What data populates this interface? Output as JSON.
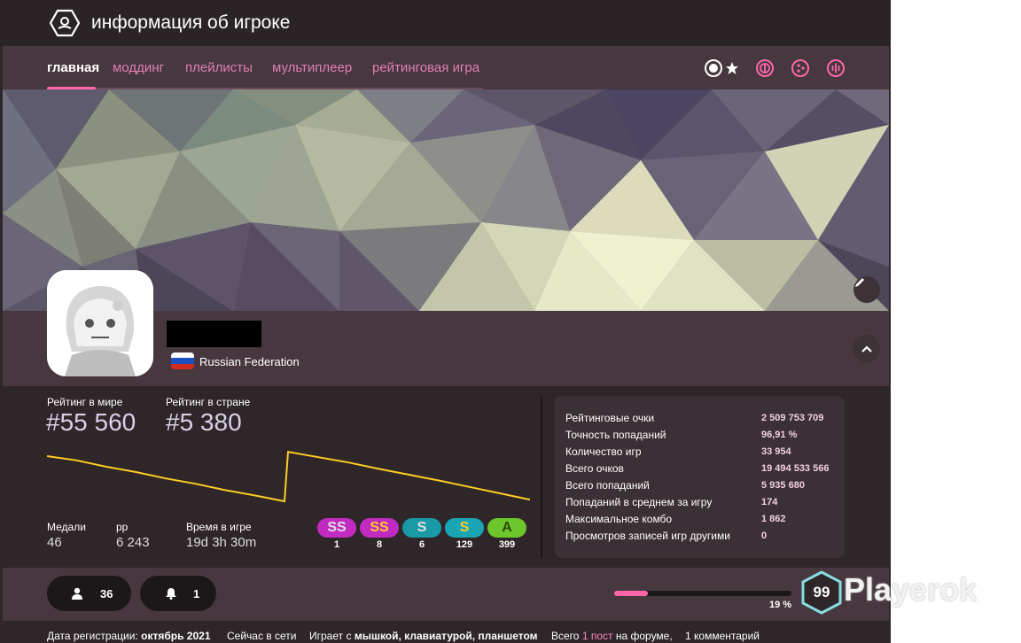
{
  "header": {
    "title": "информация об игроке",
    "icon": "user-card-icon"
  },
  "nav": {
    "tabs": [
      {
        "label": "главная",
        "active": true
      },
      {
        "label": "моддинг",
        "active": false
      },
      {
        "label": "плейлисты",
        "active": false
      },
      {
        "label": "мультиплеер",
        "active": false
      },
      {
        "label": "рейтинговая игра",
        "active": false
      }
    ],
    "mode_icons": [
      "osu-mode-icon",
      "taiko-mode-icon",
      "catch-mode-icon",
      "mania-mode-icon"
    ],
    "default_mode_marker": "star-icon"
  },
  "profile": {
    "country": "Russian Federation",
    "username_redacted": true
  },
  "ranks": {
    "global_label": "Рейтинг в мире",
    "global_value": "#55 560",
    "country_label": "Рейтинг в стране",
    "country_value": "#5 380"
  },
  "rank_history": {
    "type": "line",
    "description": "rank history",
    "values": [
      0.1,
      0.18,
      0.3,
      0.4,
      0.52,
      0.62,
      0.74,
      0.84,
      0.95,
      0.02,
      0.12,
      0.22,
      0.34,
      0.45,
      0.56,
      0.68,
      0.8,
      0.92
    ],
    "color": "#ffcc22"
  },
  "mini_stats": [
    {
      "label": "Медали",
      "value": "46"
    },
    {
      "label": "pp",
      "value": "6 243"
    },
    {
      "label": "Время в игре",
      "value": "19d 3h 30m"
    }
  ],
  "grades": [
    {
      "label": "SS",
      "count": "1",
      "color": "#c22bc2",
      "text_color": "#e0e0e0"
    },
    {
      "label": "SS",
      "count": "8",
      "color": "#c22bc2",
      "text_color": "#ffcc22"
    },
    {
      "label": "S",
      "count": "6",
      "color": "#1a9aa6",
      "text_color": "#e0e0e0"
    },
    {
      "label": "S",
      "count": "129",
      "color": "#1aa5b5",
      "text_color": "#ffcc22"
    },
    {
      "label": "A",
      "count": "399",
      "color": "#6cc62c",
      "text_color": "#2a4a10"
    }
  ],
  "stats": [
    {
      "label": "Рейтинговые очки",
      "value": "2 509 753 709"
    },
    {
      "label": "Точность попаданий",
      "value": "96,91 %"
    },
    {
      "label": "Количество игр",
      "value": "33 954"
    },
    {
      "label": "Всего очков",
      "value": "19 494 533 566"
    },
    {
      "label": "Всего попаданий",
      "value": "5 935 680"
    },
    {
      "label": "Попаданий в среднем за игру",
      "value": "174"
    },
    {
      "label": "Максимальное комбо",
      "value": "1 862"
    },
    {
      "label": "Просмотров записей игр другими",
      "value": "0"
    }
  ],
  "social": {
    "followers": "36",
    "subscribers": "1"
  },
  "level": {
    "value": "99",
    "progress_label": "19 %",
    "progress": 0.19
  },
  "info": {
    "join_label": "Дата регистрации:",
    "join_value": "октябрь 2021",
    "online": "Сейчас в сети",
    "plays_with_label": "Играет с",
    "plays_with_value": "мышкой, клавиатурой, планшетом",
    "forum_prefix": "Всего",
    "forum_posts": "1 пост",
    "forum_suffix": "на форуме,",
    "comments": "1 комментарий"
  },
  "watermark": "Playerok",
  "colors": {
    "accent": "#ff66aa",
    "background": "#2e2629",
    "panel": "#47383f",
    "chart_line": "#ffcc22"
  }
}
